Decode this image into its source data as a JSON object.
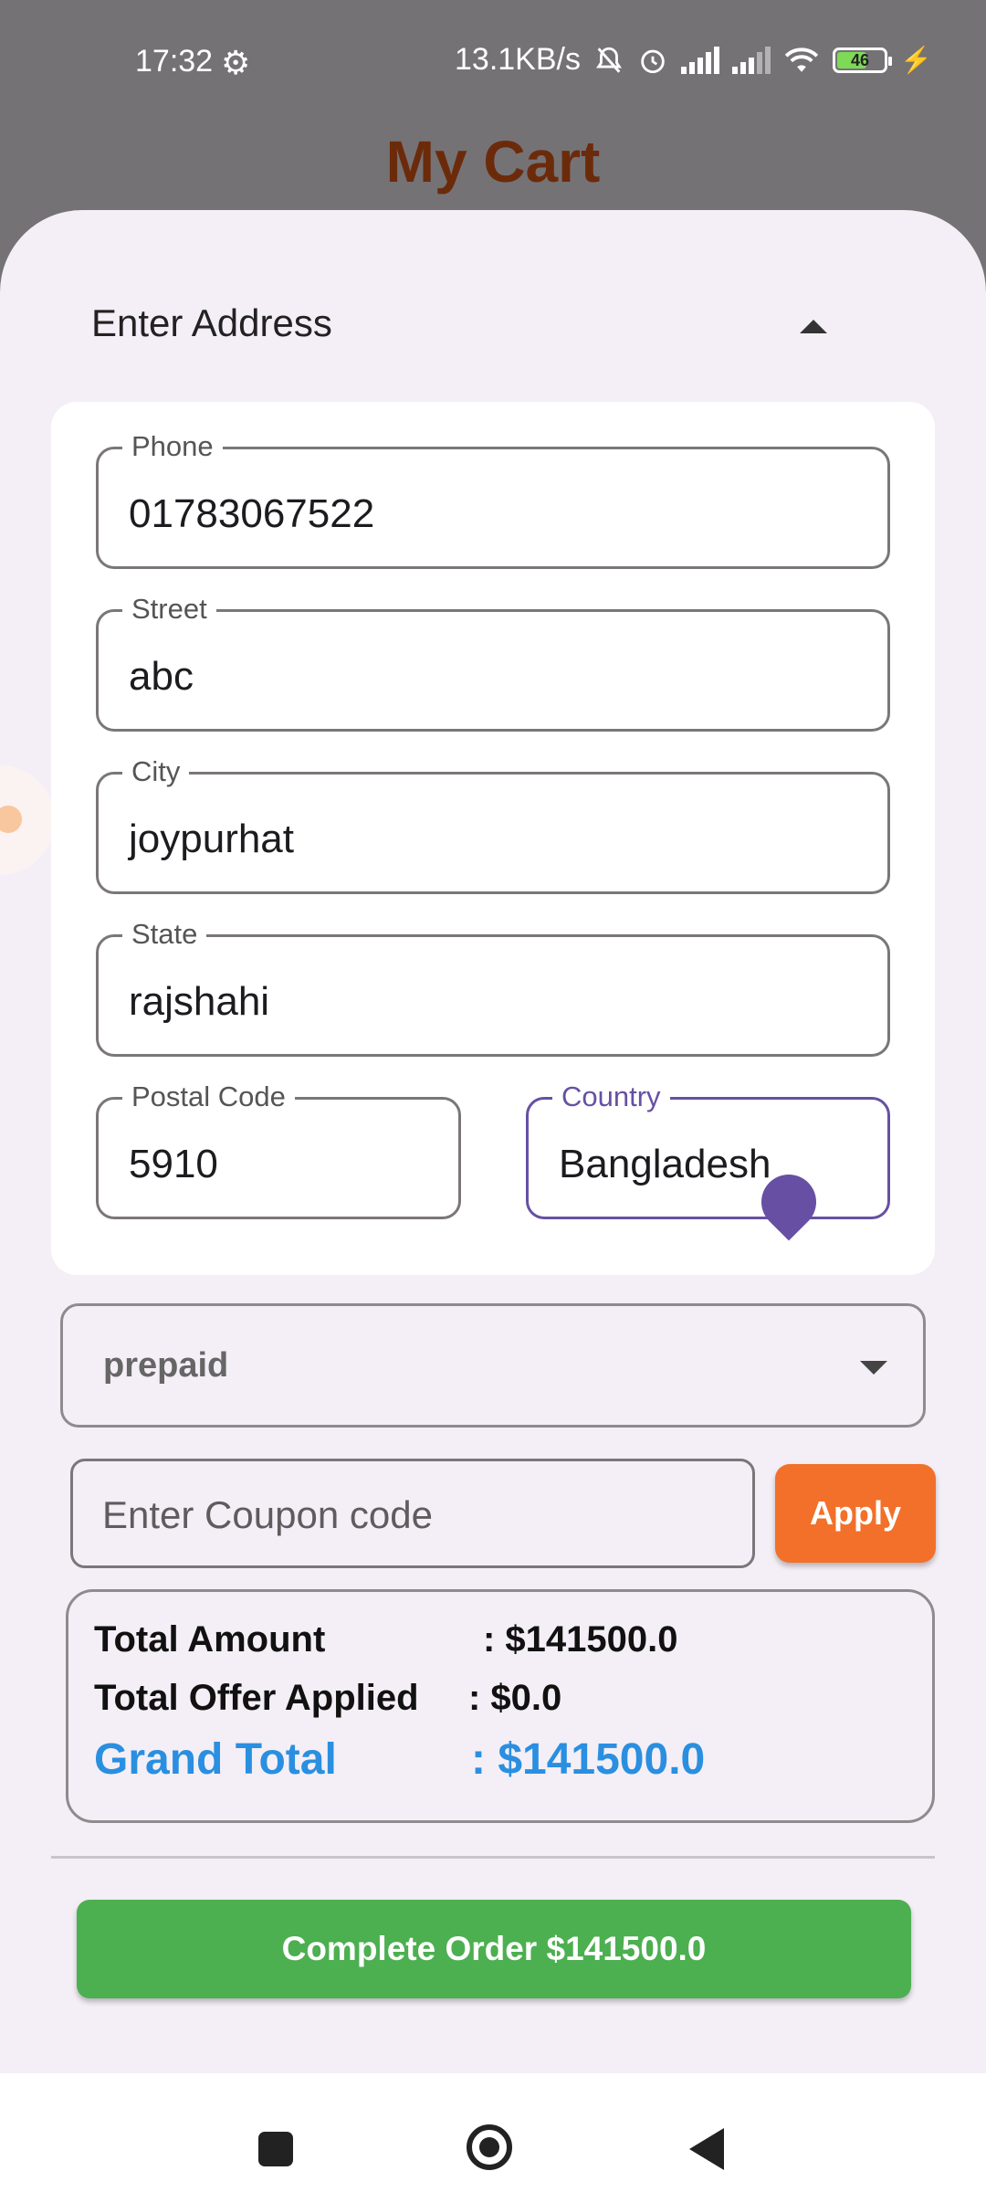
{
  "status_bar": {
    "time": "17:32",
    "speed": "13.1KB/s",
    "battery": "46",
    "icons": [
      "gear-icon",
      "bell-off-icon",
      "alarm-icon",
      "signal-icon",
      "signal-icon",
      "wifi-icon",
      "battery-icon",
      "charging-icon"
    ]
  },
  "header": {
    "title": "My Cart"
  },
  "address": {
    "header_label": "Enter Address",
    "phone": {
      "label": "Phone",
      "value": "01783067522"
    },
    "street": {
      "label": "Street",
      "value": "abc"
    },
    "city": {
      "label": "City",
      "value": "joypurhat"
    },
    "state": {
      "label": "State",
      "value": "rajshahi"
    },
    "postal": {
      "label": "Postal Code",
      "value": "5910"
    },
    "country": {
      "label": "Country",
      "value": "Bangladesh"
    }
  },
  "payment": {
    "selected": "prepaid"
  },
  "coupon": {
    "placeholder": "Enter Coupon code",
    "apply_label": "Apply"
  },
  "totals": {
    "total_amount_label": "Total Amount",
    "total_amount_value": ": $141500.0",
    "offer_label": "Total Offer Applied",
    "offer_value": ": $0.0",
    "grand_label": "Grand Total",
    "grand_value": ": $141500.0"
  },
  "complete_button": "Complete Order  $141500.0",
  "colors": {
    "title": "#6b2b0b",
    "accent": "#6750a4",
    "apply": "#f2702a",
    "grand_total": "#2a8fe0",
    "complete": "#4caf50"
  }
}
